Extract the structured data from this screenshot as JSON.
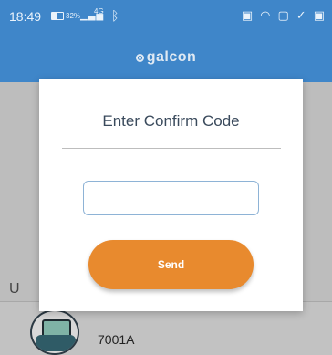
{
  "status_bar": {
    "time": "18:49",
    "battery": "32%",
    "network": "4G",
    "icons": [
      "battery-icon",
      "signal-icon",
      "bluetooth-icon",
      "calendar-icon",
      "wifi-icon",
      "sim-icon",
      "check-icon",
      "notification-icon"
    ]
  },
  "header": {
    "logo_text": "galcon",
    "background_color": "#3f86c9"
  },
  "background": {
    "section_label_partial": "U",
    "device": {
      "name": "7001A"
    }
  },
  "dialog": {
    "title": "Enter Confirm Code",
    "input": {
      "value": "",
      "placeholder": ""
    },
    "send_label": "Send",
    "accent_color": "#e88a2e"
  }
}
